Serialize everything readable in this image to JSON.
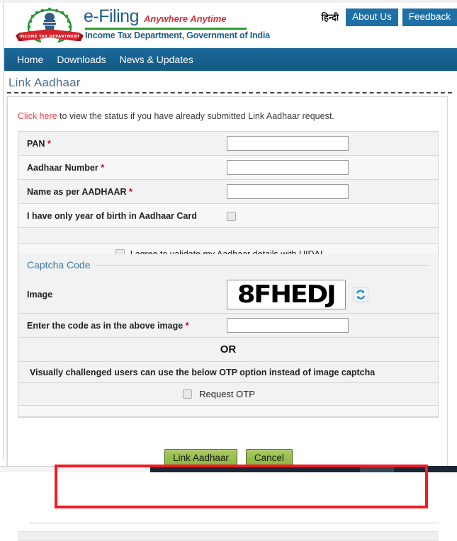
{
  "header": {
    "emblem_name": "income-tax-department-emblem",
    "brand_name": "e-Filing",
    "tagline": "Anywhere Anytime",
    "department": "Income Tax Department, Government of India",
    "hindi_label": "हिन्दी",
    "about_label": "About Us",
    "feedback_label": "Feedback",
    "accent_blue": "#1f6fa5",
    "accent_green": "#2e9e2e",
    "tagline_red": "#d2333c"
  },
  "nav": {
    "items": [
      {
        "label": "Home"
      },
      {
        "label": "Downloads"
      },
      {
        "label": "News & Updates"
      }
    ],
    "bar_color": "#15608c"
  },
  "page": {
    "title": "Link Aadhaar"
  },
  "notice": {
    "link_text": "Click here",
    "rest_text": " to view the status if you have already submitted Link Aadhaar request.",
    "link_color": "#e8414a"
  },
  "form": {
    "rows": [
      {
        "label": "PAN",
        "required": "*",
        "value": "",
        "type": "text"
      },
      {
        "label": "Aadhaar Number",
        "required": "*",
        "value": "",
        "type": "text"
      },
      {
        "label": "Name as per AADHAAR",
        "required": "*",
        "value": "",
        "type": "text"
      },
      {
        "label": "I have only year of birth in Aadhaar Card",
        "required": "",
        "value": "",
        "type": "checkbox"
      }
    ],
    "consent_label": "I agree to validate my Aadhaar details with UIDAI",
    "consent_checked": false
  },
  "captcha": {
    "section_title": "Captcha Code",
    "image_row_label": "Image",
    "captcha_value": "8FHEDJ",
    "refresh_icon": "refresh-icon",
    "entry_label": "Enter the code as in the above image",
    "entry_required": "*",
    "entry_value": "",
    "or_label": "OR"
  },
  "otp": {
    "notice": "Visually challenged users can use the below OTP option instead of image captcha",
    "request_label": "Request OTP",
    "request_checked": false,
    "highlight_color": "#ee1c25"
  },
  "actions": {
    "submit_label": "Link Aadhaar",
    "cancel_label": "Cancel",
    "button_color": "#97bf4d"
  }
}
